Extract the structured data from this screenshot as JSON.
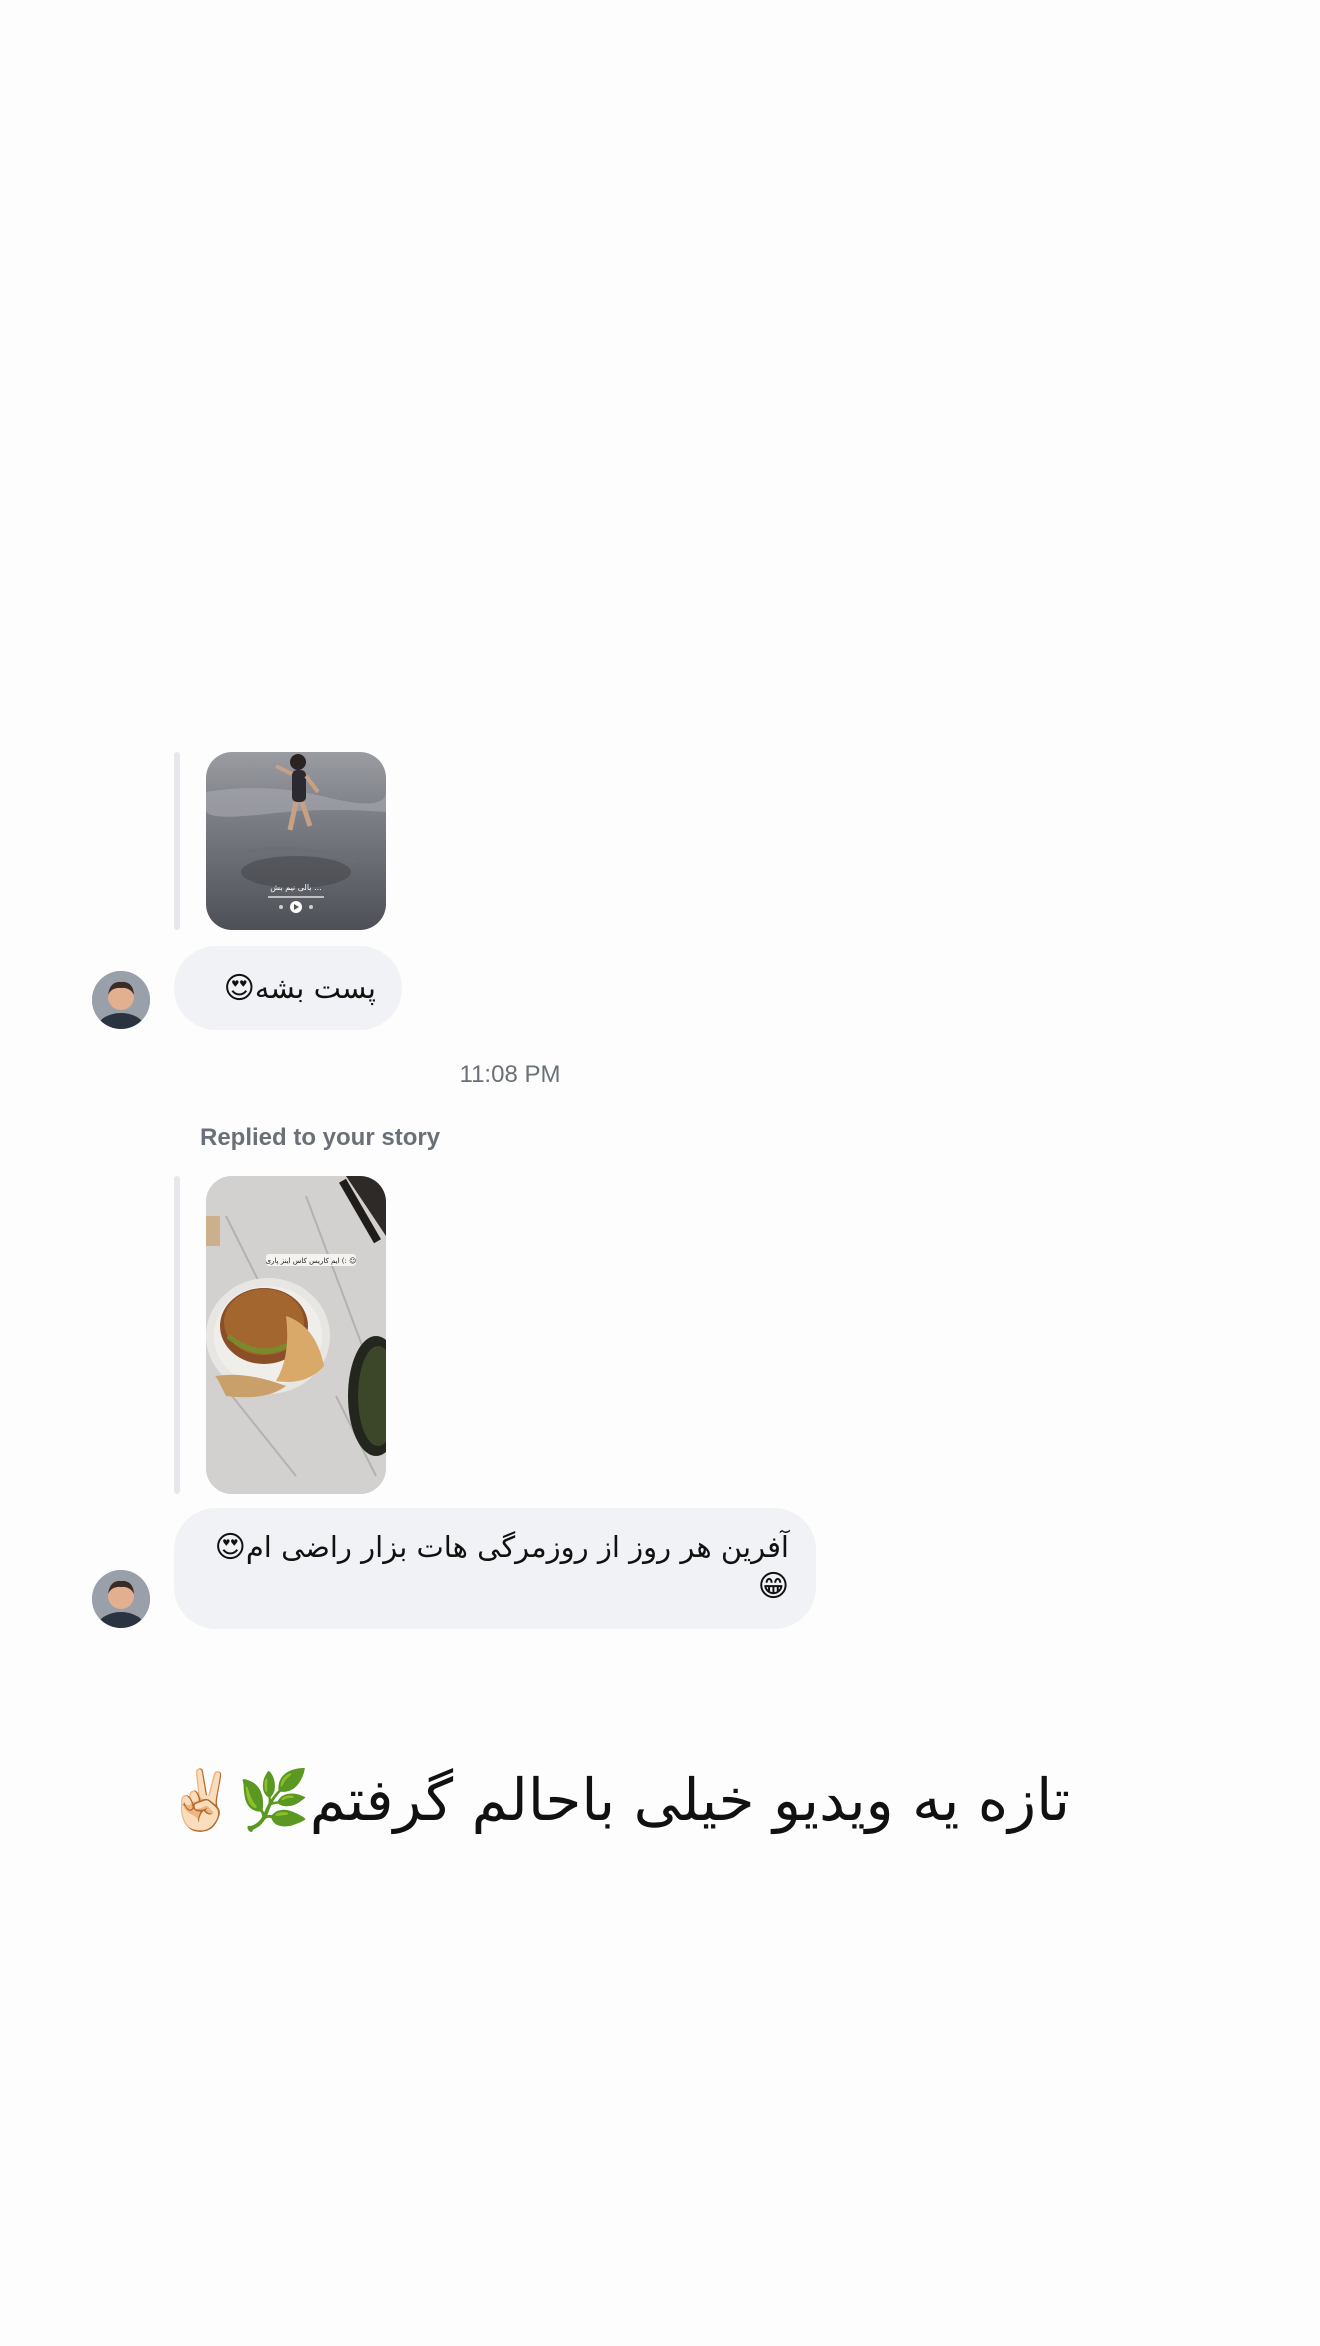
{
  "thread": {
    "message_1": {
      "story_overlay_text": "بالی نیم بش ...",
      "text": "پست بشه",
      "emoji": "😍"
    },
    "timestamp": "11:08 PM",
    "message_2": {
      "reply_label": "Replied to your story",
      "story_sticker_text": "ایم کاریس کاس اینز پاری (: ☺",
      "text_line1": "آفرین هر روز از روزمرگی هات بزار راضی ام",
      "emoji_line1": "😍",
      "emoji_line2": "😁"
    }
  },
  "caption": {
    "text": "تازه یه ویدیو خیلی باحالم گرفتم",
    "emojis": "🌿✌🏻"
  }
}
